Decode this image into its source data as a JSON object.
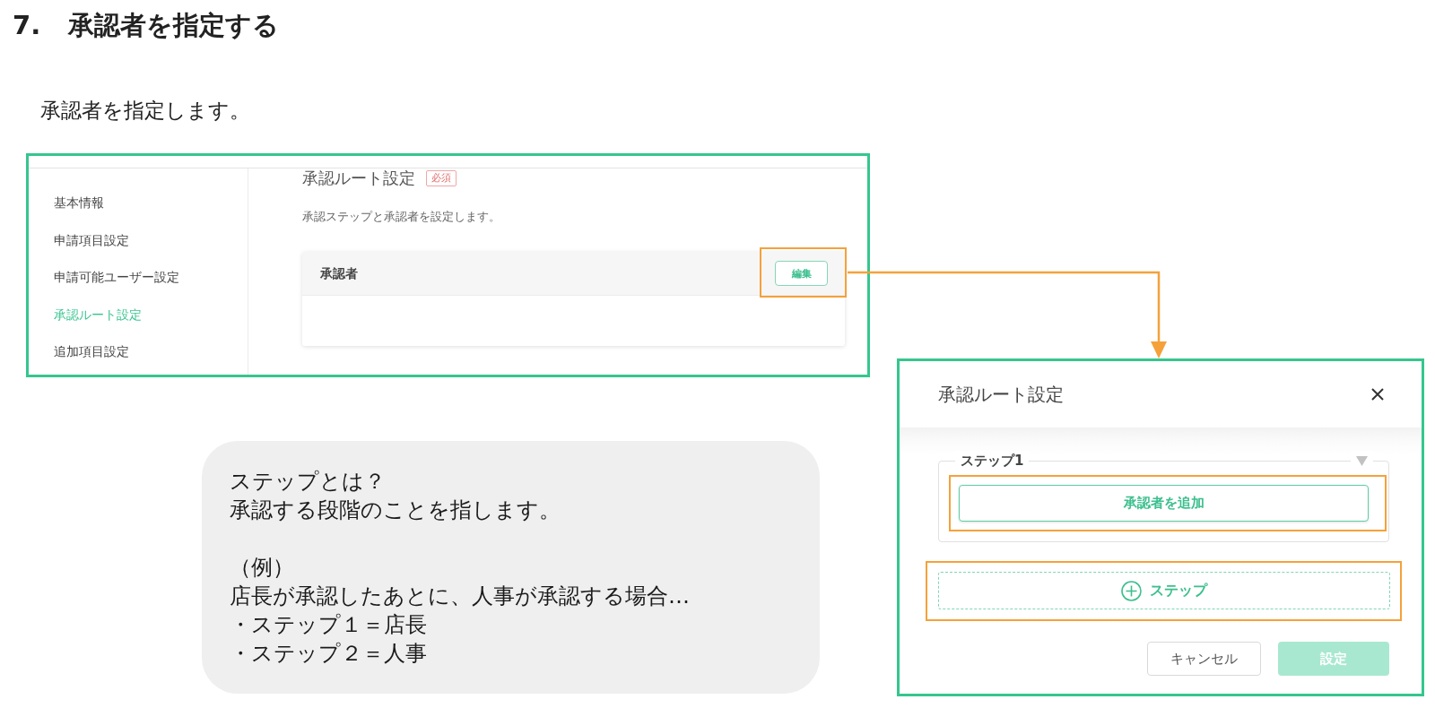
{
  "section": {
    "number": "7.",
    "title": "承認者を指定する"
  },
  "intro": "承認者を指定します。",
  "settings_screen": {
    "sidebar": {
      "items": [
        {
          "label": "基本情報",
          "selected": false
        },
        {
          "label": "申請項目設定",
          "selected": false
        },
        {
          "label": "申請可能ユーザー設定",
          "selected": false
        },
        {
          "label": "承認ルート設定",
          "selected": true
        },
        {
          "label": "追加項目設定",
          "selected": false
        }
      ]
    },
    "heading": "承認ルート設定",
    "badge": "必須",
    "description": "承認ステップと承認者を設定します。",
    "approver_card": {
      "label": "承認者",
      "edit_button": {
        "label": "編集",
        "highlighted": true
      }
    }
  },
  "dialog": {
    "title": "承認ルート設定",
    "steps": [
      {
        "label": "ステップ1",
        "add_button": {
          "label": "承認者を追加",
          "highlighted": true
        }
      }
    ],
    "add_step_button": {
      "label": "ステップ",
      "highlighted": true
    },
    "buttons": [
      {
        "label": "キャンセル",
        "kind": "secondary",
        "disabled": false
      },
      {
        "label": "設定",
        "kind": "primary",
        "disabled": true
      }
    ]
  },
  "note": {
    "question": "ステップとは？",
    "answer": "承認する段階のことを指します。",
    "example_label": "（例）",
    "example_text": "店長が承認したあとに、人事が承認する場合…",
    "example_items": [
      "・ステップ１＝店長",
      "・ステップ２＝人事"
    ]
  }
}
